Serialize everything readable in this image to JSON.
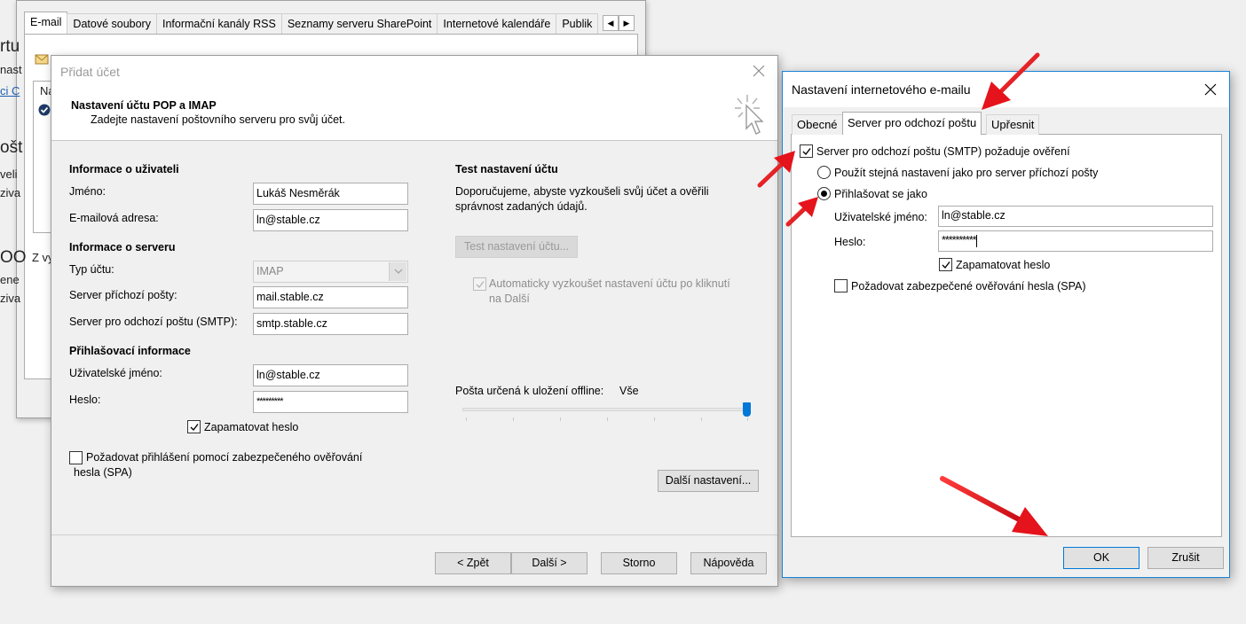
{
  "background_window": {
    "tabs": [
      "E-mail",
      "Datové soubory",
      "Informační kanály RSS",
      "Seznamy serveru SharePoint",
      "Internetové kalendáře",
      "Publik"
    ],
    "list_header_clip": "Na",
    "left_clips": [
      "rtu",
      "nast",
      "ci C",
      "ošt",
      "veli",
      "ziva",
      "OO",
      "ene",
      "ziva"
    ],
    "bottom_clip": "Z vy"
  },
  "add_account": {
    "title": "Přidat účet",
    "header_title": "Nastavení účtu POP a IMAP",
    "header_subtitle": "Zadejte nastavení poštovního serveru pro svůj účet.",
    "user_info": {
      "heading": "Informace o uživateli",
      "name_label": "Jméno:",
      "name_value": "Lukáš Nesměrák",
      "email_label": "E-mailová adresa:",
      "email_value": "ln@stable.cz"
    },
    "server_info": {
      "heading": "Informace o serveru",
      "type_label": "Typ účtu:",
      "type_value": "IMAP",
      "incoming_label": "Server příchozí pošty:",
      "incoming_value": "mail.stable.cz",
      "outgoing_label": "Server pro odchozí poštu (SMTP):",
      "outgoing_value": "smtp.stable.cz"
    },
    "login_info": {
      "heading": "Přihlašovací informace",
      "username_label": "Uživatelské jméno:",
      "username_value": "ln@stable.cz",
      "password_label": "Heslo:",
      "password_value": "*********",
      "remember_label": "Zapamatovat heslo",
      "remember_checked": true,
      "spa_label_line1": "Požadovat přihlášení pomocí zabezpečeného ověřování",
      "spa_label_line2": "hesla (SPA)",
      "spa_checked": false
    },
    "test": {
      "heading": "Test nastavení účtu",
      "desc_line1": "Doporučujeme, abyste vyzkoušeli svůj účet a ověřili",
      "desc_line2": "správnost zadaných údajů.",
      "test_button": "Test nastavení účtu...",
      "auto_test_line1": "Automaticky vyzkoušet nastavení účtu po kliknutí",
      "auto_test_line2": "na Další",
      "auto_test_checked": true
    },
    "offline": {
      "label": "Pošta určená k uložení offline:",
      "value": "Vše",
      "slider_position": 1.0
    },
    "more_settings_button": "Další nastavení...",
    "footer": {
      "back": "< Zpět",
      "next": "Další >",
      "cancel": "Storno",
      "help": "Nápověda"
    }
  },
  "internet_settings": {
    "title": "Nastavení internetového e-mailu",
    "tabs": [
      "Obecné",
      "Server pro odchozí poštu",
      "Upřesnit"
    ],
    "active_tab": "Server pro odchozí poštu",
    "smtp_auth_label": "Server pro odchozí poštu (SMTP) požaduje ověření",
    "smtp_auth_checked": true,
    "same_settings_label": "Použít stejná nastavení jako pro server příchozí pošty",
    "login_as_label": "Přihlašovat se jako",
    "selected_option": "login_as",
    "username_label": "Uživatelské jméno:",
    "username_value": "ln@stable.cz",
    "password_label": "Heslo:",
    "password_value": "**********",
    "remember_label": "Zapamatovat heslo",
    "remember_checked": true,
    "spa_label": "Požadovat zabezpečené ověřování hesla (SPA)",
    "spa_checked": false,
    "ok_button": "OK",
    "cancel_button": "Zrušit"
  },
  "colors": {
    "annotation_arrow": "#e5131b",
    "accent": "#0078d7"
  }
}
